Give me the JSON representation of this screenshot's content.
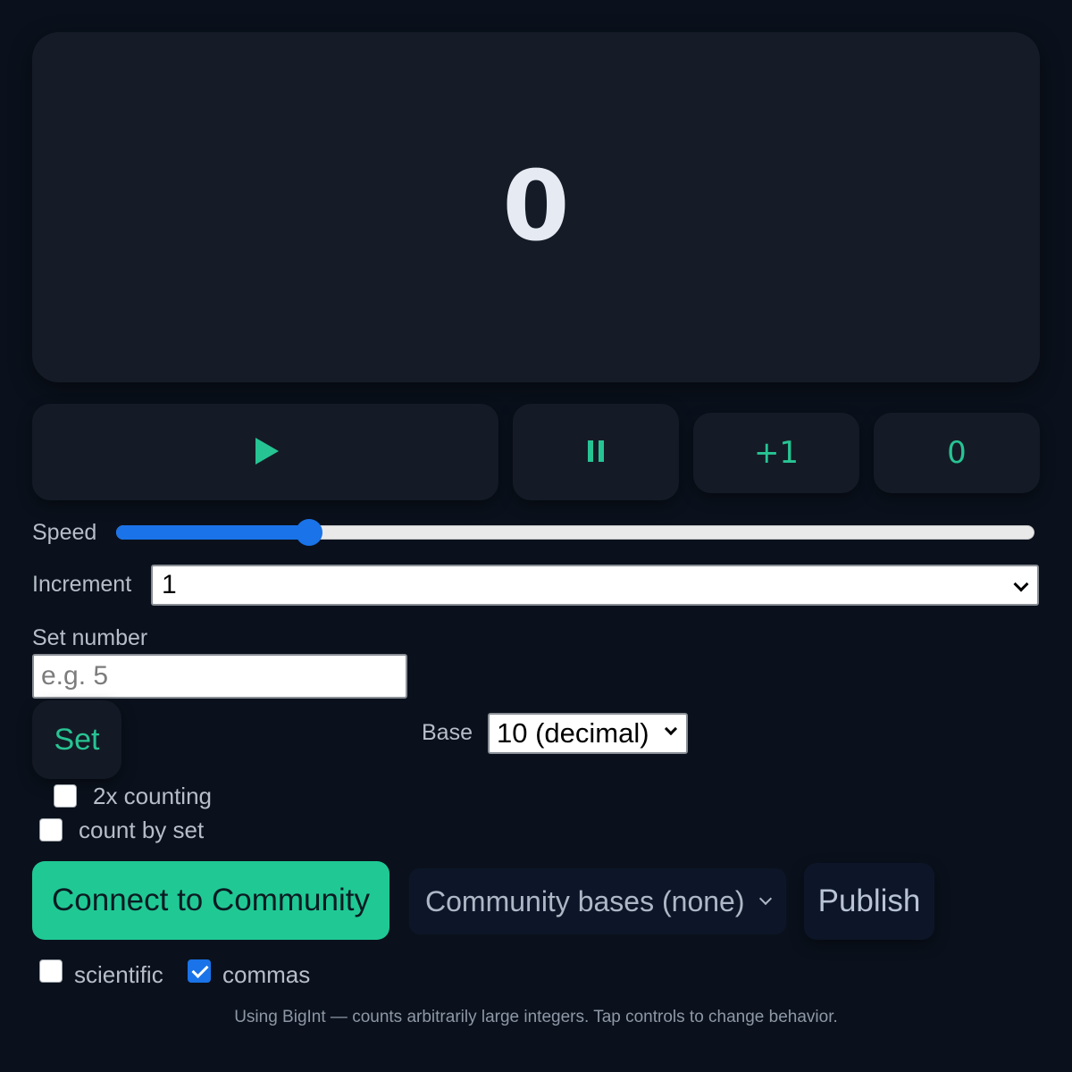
{
  "display": {
    "value": "0"
  },
  "controls": {
    "play_icon": "play-icon",
    "pause_icon": "pause-icon",
    "increment_label": "+1",
    "reset_label": "0"
  },
  "speed": {
    "label": "Speed",
    "value_fraction": 0.21
  },
  "increment": {
    "label": "Increment",
    "selected": "1"
  },
  "set_number": {
    "label": "Set number",
    "placeholder": "e.g. 5",
    "button_label": "Set"
  },
  "base": {
    "label": "Base",
    "selected": "10 (decimal)"
  },
  "options": {
    "two_x": {
      "label": "2x counting",
      "checked": false
    },
    "count_by_set": {
      "label": "count by set",
      "checked": false
    },
    "scientific": {
      "label": "scientific",
      "checked": false
    },
    "commas": {
      "label": "commas",
      "checked": true
    }
  },
  "community": {
    "connect_label": "Connect to Community",
    "bases_selected": "Community bases (none)",
    "publish_label": "Publish"
  },
  "footer": "Using BigInt — counts arbitrarily large integers. Tap controls to change behavior.",
  "colors": {
    "accent": "#27c493",
    "primary_button": "#20c994",
    "slider": "#1a73e8",
    "background": "#0a111c",
    "panel": "#161c27"
  }
}
